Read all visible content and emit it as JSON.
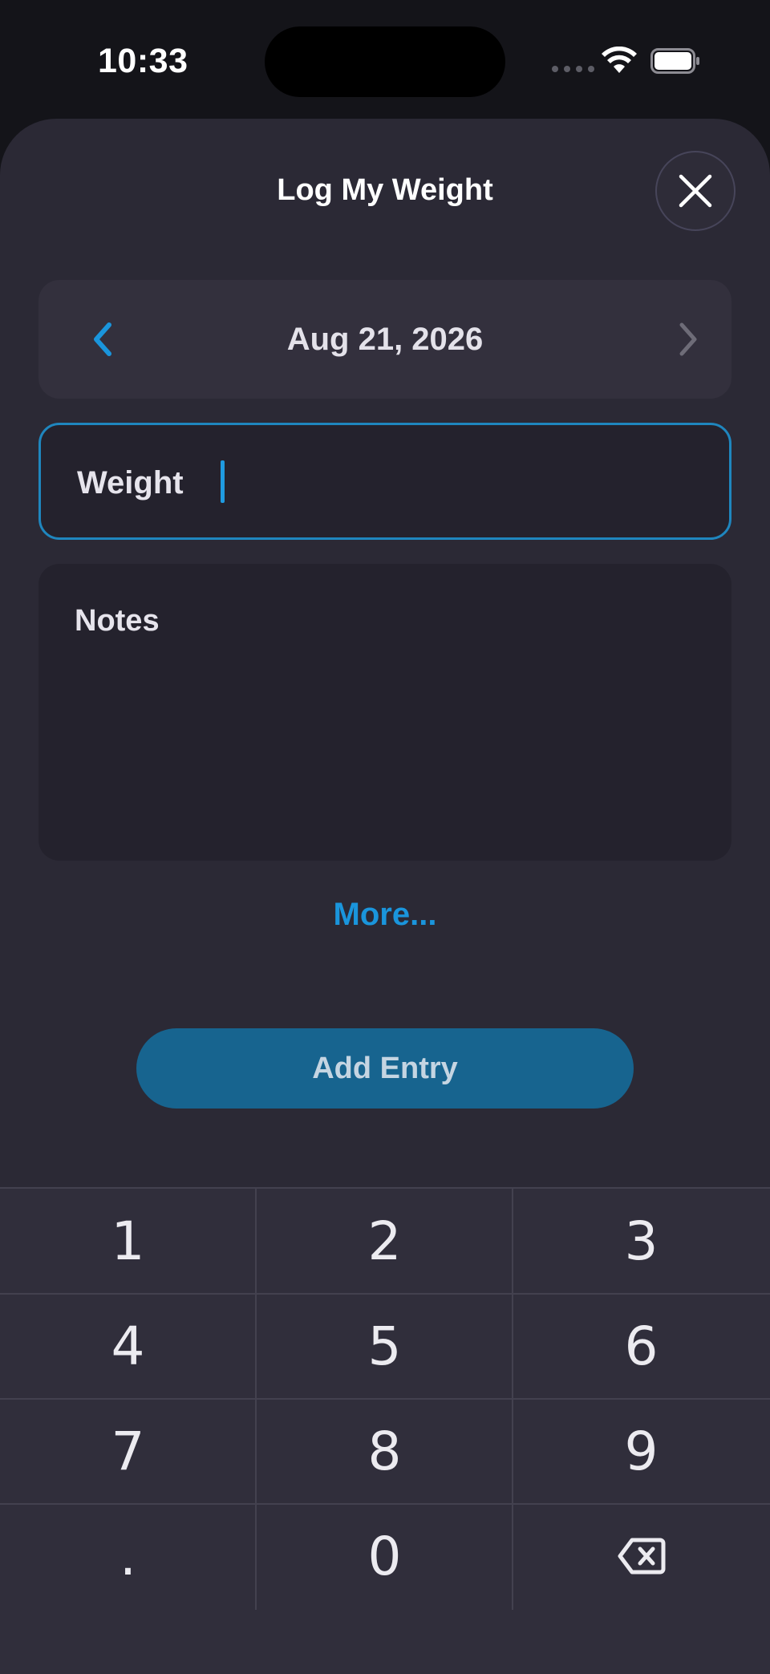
{
  "status_bar": {
    "time": "10:33",
    "icons": [
      "signal-dots-icon",
      "wifi-icon",
      "battery-icon"
    ]
  },
  "sheet": {
    "title": "Log My Weight",
    "close_icon": "close-icon"
  },
  "date_selector": {
    "date": "Aug 21, 2026",
    "prev_icon": "chevron-left-icon",
    "next_icon": "chevron-right-icon"
  },
  "weight_field": {
    "label": "Weight",
    "value": ""
  },
  "notes_field": {
    "label": "Notes"
  },
  "more_link": "More...",
  "add_entry_button": "Add Entry",
  "keypad": {
    "keys": [
      "1",
      "2",
      "3",
      "4",
      "5",
      "6",
      "7",
      "8",
      "9",
      ".",
      "0"
    ],
    "delete_icon": "backspace-icon"
  },
  "colors": {
    "accent": "#1a95dc",
    "button_bg": "#17648f",
    "sheet_bg": "#2b2935",
    "field_bg": "#24222d"
  }
}
